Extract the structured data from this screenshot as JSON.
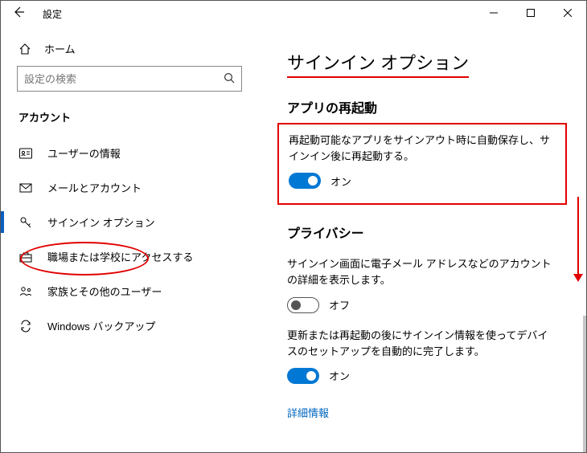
{
  "window": {
    "title": "設定"
  },
  "sidebar": {
    "home": "ホーム",
    "search_placeholder": "設定の検索",
    "section": "アカウント",
    "items": [
      {
        "label": "ユーザーの情報"
      },
      {
        "label": "メールとアカウント"
      },
      {
        "label": "サインイン オプション"
      },
      {
        "label": "職場または学校にアクセスする"
      },
      {
        "label": "家族とその他のユーザー"
      },
      {
        "label": "Windows バックアップ"
      }
    ]
  },
  "content": {
    "heading": "サインイン オプション",
    "appRestart": {
      "title": "アプリの再起動",
      "desc": "再起動可能なアプリをサインアウト時に自動保存し、サインイン後に再起動する。",
      "state_label": "オン"
    },
    "privacy": {
      "title": "プライバシー",
      "desc1": "サインイン画面に電子メール アドレスなどのアカウントの詳細を表示します。",
      "state1_label": "オフ",
      "desc2": "更新または再起動の後にサインイン情報を使ってデバイスのセットアップを自動的に完了します。",
      "state2_label": "オン",
      "link": "詳細情報"
    }
  }
}
